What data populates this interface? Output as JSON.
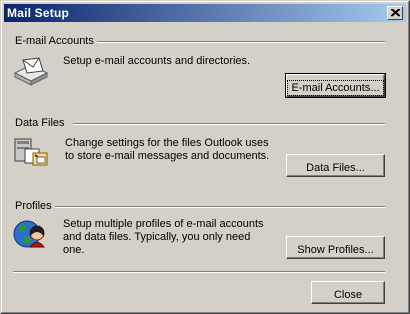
{
  "window": {
    "title": "Mail Setup"
  },
  "sections": {
    "email_accounts": {
      "label": "E-mail Accounts",
      "description": "Setup e-mail accounts and directories.",
      "button": "E-mail Accounts..."
    },
    "data_files": {
      "label": "Data Files",
      "description_line1": "Change settings for the files Outlook uses",
      "description_line2": "to store e-mail messages and documents.",
      "button": "Data Files..."
    },
    "profiles": {
      "label": "Profiles",
      "description_line1": "Setup multiple profiles of e-mail accounts",
      "description_line2": "and data files. Typically, you only need",
      "description_line3": "one.",
      "button": "Show Profiles..."
    }
  },
  "footer": {
    "close": "Close"
  },
  "icons": {
    "title_close": "close-icon",
    "email_accounts": "mail-tray-icon",
    "data_files": "data-files-icon",
    "profiles": "profiles-globe-icon"
  }
}
